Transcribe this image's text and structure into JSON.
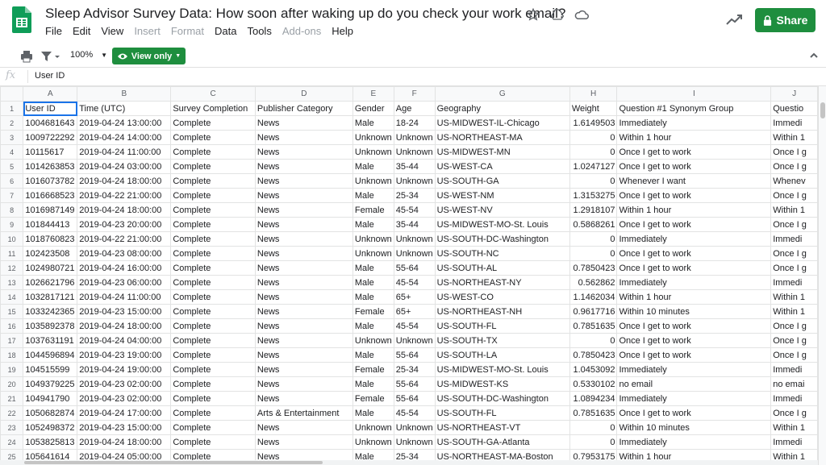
{
  "doc": {
    "title": "Sleep Advisor Survey Data: How soon after waking up do you check your work email?"
  },
  "menu": [
    {
      "label": "File",
      "disabled": false
    },
    {
      "label": "Edit",
      "disabled": false
    },
    {
      "label": "View",
      "disabled": false
    },
    {
      "label": "Insert",
      "disabled": true
    },
    {
      "label": "Format",
      "disabled": true
    },
    {
      "label": "Data",
      "disabled": false
    },
    {
      "label": "Tools",
      "disabled": false
    },
    {
      "label": "Add-ons",
      "disabled": true
    },
    {
      "label": "Help",
      "disabled": false
    }
  ],
  "share": {
    "label": "Share"
  },
  "toolbar": {
    "zoom": "100%",
    "view_only": "View only"
  },
  "formula_bar": {
    "fx": "fx",
    "value": "User ID"
  },
  "colors": {
    "accent_green": "#1e8e3e",
    "selection_blue": "#1a73e8"
  },
  "icons": [
    "sheets-logo-icon",
    "star-icon",
    "drive-icon",
    "cloud-icon",
    "trend-icon",
    "lock-icon",
    "print-icon",
    "filter-icon",
    "eye-icon",
    "chevron-up-icon"
  ],
  "sheet": {
    "columns": [
      "A",
      "B",
      "C",
      "D",
      "E",
      "F",
      "G",
      "H",
      "I",
      "J"
    ],
    "rows": [
      [
        "1",
        "User ID",
        "Time (UTC)",
        "Survey Completion",
        "Publisher Category",
        "Gender",
        "Age",
        "Geography",
        "Weight",
        "Question #1 Synonym Group",
        "Questio"
      ],
      [
        "2",
        "1004681643",
        "2019-04-24 13:00:00",
        "Complete",
        "News",
        "Male",
        "18-24",
        "US-MIDWEST-IL-Chicago",
        "1.6149503",
        "Immediately",
        "Immedi"
      ],
      [
        "3",
        "1009722292",
        "2019-04-24 14:00:00",
        "Complete",
        "News",
        "Unknown",
        "Unknown",
        "US-NORTHEAST-MA",
        "0",
        "Within 1 hour",
        "Within 1"
      ],
      [
        "4",
        "10115617",
        "2019-04-24 11:00:00",
        "Complete",
        "News",
        "Unknown",
        "Unknown",
        "US-MIDWEST-MN",
        "0",
        "Once I get to work",
        "Once I g"
      ],
      [
        "5",
        "1014263853",
        "2019-04-24 03:00:00",
        "Complete",
        "News",
        "Male",
        "35-44",
        "US-WEST-CA",
        "1.0247127",
        "Once I get to work",
        "Once I g"
      ],
      [
        "6",
        "1016073782",
        "2019-04-24 18:00:00",
        "Complete",
        "News",
        "Unknown",
        "Unknown",
        "US-SOUTH-GA",
        "0",
        "Whenever I want",
        "Whenev"
      ],
      [
        "7",
        "1016668523",
        "2019-04-22 21:00:00",
        "Complete",
        "News",
        "Male",
        "25-34",
        "US-WEST-NM",
        "1.3153275",
        "Once I get to work",
        "Once I g"
      ],
      [
        "8",
        "1016987149",
        "2019-04-24 18:00:00",
        "Complete",
        "News",
        "Female",
        "45-54",
        "US-WEST-NV",
        "1.2918107",
        "Within 1 hour",
        "Within 1"
      ],
      [
        "9",
        "101844413",
        "2019-04-23 20:00:00",
        "Complete",
        "News",
        "Male",
        "35-44",
        "US-MIDWEST-MO-St. Louis",
        "0.5868261",
        "Once I get to work",
        "Once I g"
      ],
      [
        "10",
        "1018760823",
        "2019-04-22 21:00:00",
        "Complete",
        "News",
        "Unknown",
        "Unknown",
        "US-SOUTH-DC-Washington",
        "0",
        "Immediately",
        "Immedi"
      ],
      [
        "11",
        "102423508",
        "2019-04-23 08:00:00",
        "Complete",
        "News",
        "Unknown",
        "Unknown",
        "US-SOUTH-NC",
        "0",
        "Once I get to work",
        "Once I g"
      ],
      [
        "12",
        "1024980721",
        "2019-04-24 16:00:00",
        "Complete",
        "News",
        "Male",
        "55-64",
        "US-SOUTH-AL",
        "0.7850423",
        "Once I get to work",
        "Once I g"
      ],
      [
        "13",
        "1026621796",
        "2019-04-23 06:00:00",
        "Complete",
        "News",
        "Male",
        "45-54",
        "US-NORTHEAST-NY",
        "0.562862",
        "Immediately",
        "Immedi"
      ],
      [
        "14",
        "1032817121",
        "2019-04-24 11:00:00",
        "Complete",
        "News",
        "Male",
        "65+",
        "US-WEST-CO",
        "1.1462034",
        "Within 1 hour",
        "Within 1"
      ],
      [
        "15",
        "1033242365",
        "2019-04-23 15:00:00",
        "Complete",
        "News",
        "Female",
        "65+",
        "US-NORTHEAST-NH",
        "0.9617716",
        "Within 10 minutes",
        "Within 1"
      ],
      [
        "16",
        "1035892378",
        "2019-04-24 18:00:00",
        "Complete",
        "News",
        "Male",
        "45-54",
        "US-SOUTH-FL",
        "0.7851635",
        "Once I get to work",
        "Once I g"
      ],
      [
        "17",
        "1037631191",
        "2019-04-24 04:00:00",
        "Complete",
        "News",
        "Unknown",
        "Unknown",
        "US-SOUTH-TX",
        "0",
        "Once I get to work",
        "Once I g"
      ],
      [
        "18",
        "1044596894",
        "2019-04-23 19:00:00",
        "Complete",
        "News",
        "Male",
        "55-64",
        "US-SOUTH-LA",
        "0.7850423",
        "Once I get to work",
        "Once I g"
      ],
      [
        "19",
        "104515599",
        "2019-04-24 19:00:00",
        "Complete",
        "News",
        "Female",
        "25-34",
        "US-MIDWEST-MO-St. Louis",
        "1.0453092",
        "Immediately",
        "Immedi"
      ],
      [
        "20",
        "1049379225",
        "2019-04-23 02:00:00",
        "Complete",
        "News",
        "Male",
        "55-64",
        "US-MIDWEST-KS",
        "0.5330102",
        "no email",
        "no emai"
      ],
      [
        "21",
        "104941790",
        "2019-04-23 02:00:00",
        "Complete",
        "News",
        "Female",
        "55-64",
        "US-SOUTH-DC-Washington",
        "1.0894234",
        "Immediately",
        "Immedi"
      ],
      [
        "22",
        "1050682874",
        "2019-04-24 17:00:00",
        "Complete",
        "Arts & Entertainment",
        "Male",
        "45-54",
        "US-SOUTH-FL",
        "0.7851635",
        "Once I get to work",
        "Once I g"
      ],
      [
        "23",
        "1052498372",
        "2019-04-23 15:00:00",
        "Complete",
        "News",
        "Unknown",
        "Unknown",
        "US-NORTHEAST-VT",
        "0",
        "Within 10 minutes",
        "Within 1"
      ],
      [
        "24",
        "1053825813",
        "2019-04-24 18:00:00",
        "Complete",
        "News",
        "Unknown",
        "Unknown",
        "US-SOUTH-GA-Atlanta",
        "0",
        "Immediately",
        "Immedi"
      ],
      [
        "25",
        "105641614",
        "2019-04-24 05:00:00",
        "Complete",
        "News",
        "Male",
        "25-34",
        "US-NORTHEAST-MA-Boston",
        "0.7953175",
        "Within 1 hour",
        "Within 1"
      ]
    ]
  }
}
